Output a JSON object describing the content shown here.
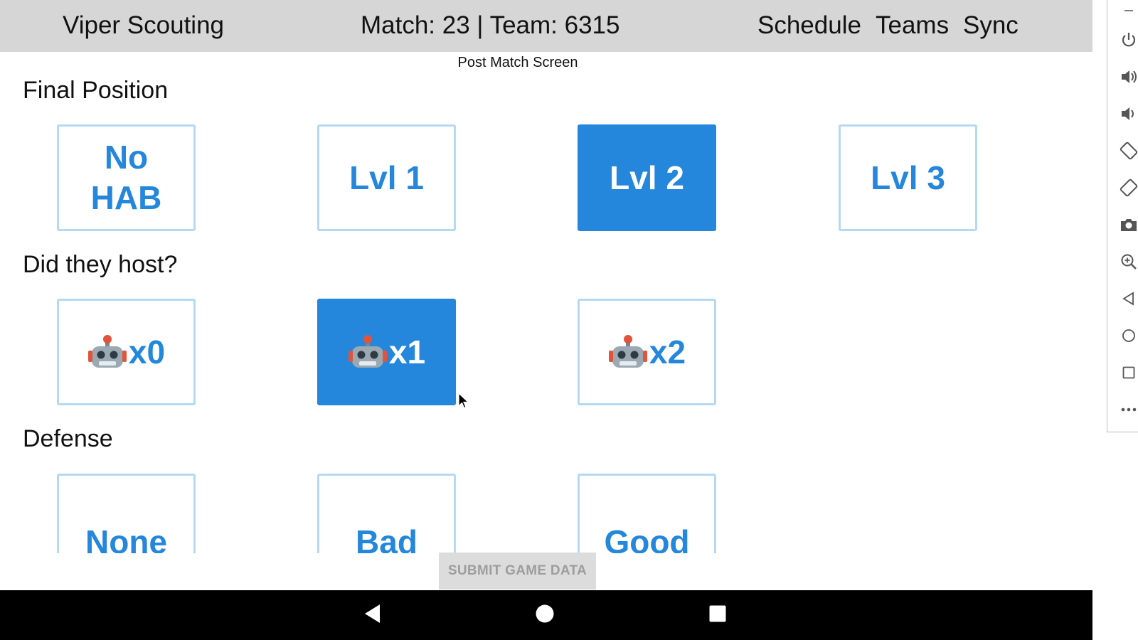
{
  "header": {
    "app_title": "Viper Scouting",
    "match_info": "Match: 23 | Team: 6315",
    "nav": [
      "Schedule",
      "Teams",
      "Sync"
    ]
  },
  "screen_title": "Post Match Screen",
  "sections": {
    "final_position": {
      "label": "Final Position",
      "options": [
        {
          "label": "No HAB",
          "selected": false
        },
        {
          "label": "Lvl 1",
          "selected": false
        },
        {
          "label": "Lvl 2",
          "selected": true
        },
        {
          "label": "Lvl 3",
          "selected": false
        }
      ]
    },
    "host": {
      "label": "Did they host?",
      "options": [
        {
          "label": "x0",
          "icon": "robot-icon",
          "selected": false
        },
        {
          "label": "x1",
          "icon": "robot-icon",
          "selected": true
        },
        {
          "label": "x2",
          "icon": "robot-icon",
          "selected": false
        }
      ]
    },
    "defense": {
      "label": "Defense",
      "options": [
        {
          "label": "None",
          "selected": false
        },
        {
          "label": "Bad",
          "selected": false
        },
        {
          "label": "Good",
          "selected": false
        }
      ]
    }
  },
  "submit_label": "SUBMIT GAME DATA",
  "colors": {
    "accent": "#2487db",
    "header_bg": "#d6d6d6",
    "button_border": "#b5d8f3",
    "submit_bg": "#dcdcdc",
    "submit_text": "#9d9d9d"
  },
  "system_nav": [
    "back-icon",
    "home-icon",
    "recents-icon"
  ],
  "emulator_toolbar": [
    "minimize-icon",
    "power-icon",
    "volume-up-icon",
    "volume-down-icon",
    "rotate-left-icon",
    "rotate-right-icon",
    "camera-icon",
    "zoom-icon",
    "back-icon",
    "home-icon",
    "overview-icon",
    "more-icon"
  ]
}
